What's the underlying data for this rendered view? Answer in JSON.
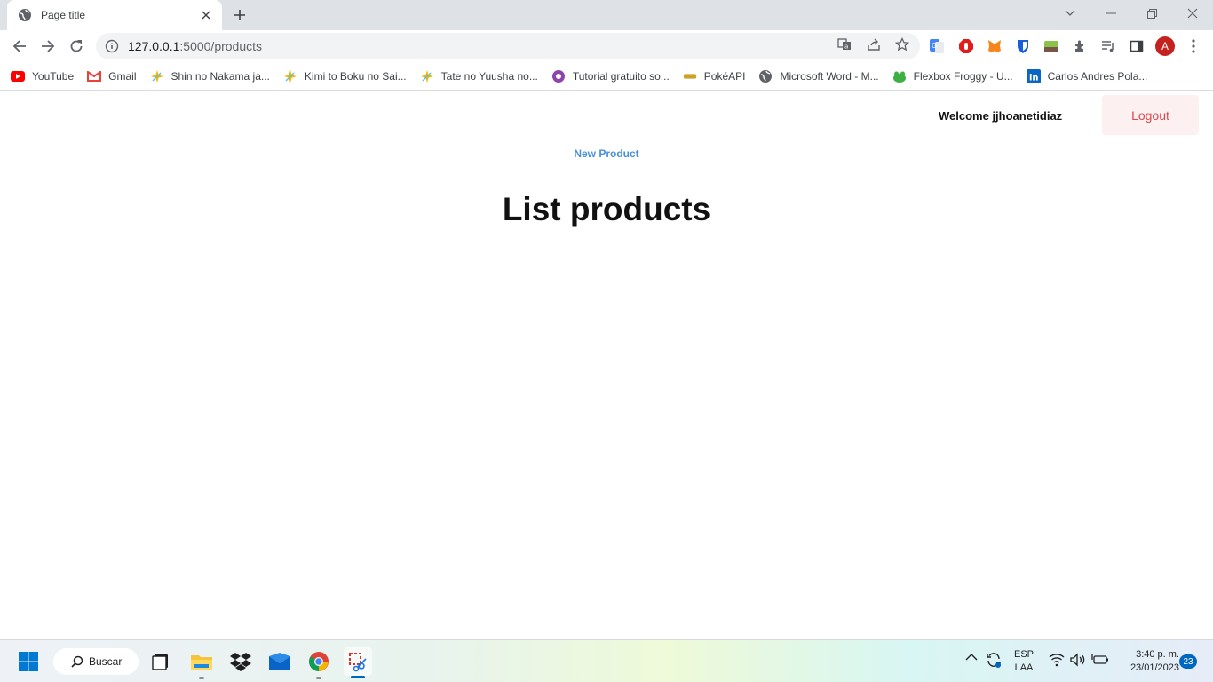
{
  "browser": {
    "tab": {
      "title": "Page title",
      "favicon": "globe-icon"
    },
    "address": {
      "host": "127.0.0.1",
      "path": ":5000/products"
    },
    "avatar_letter": "A",
    "bookmarks": [
      {
        "label": "YouTube",
        "icon": "youtube-icon",
        "color": "#ff0000"
      },
      {
        "label": "Gmail",
        "icon": "gmail-icon",
        "color": "#ea4335"
      },
      {
        "label": "Shin no Nakama ja...",
        "icon": "star-sparkle-icon",
        "color": "#f4b400"
      },
      {
        "label": "Kimi to Boku no Sai...",
        "icon": "star-sparkle-icon",
        "color": "#f4b400"
      },
      {
        "label": "Tate no Yuusha no...",
        "icon": "star-sparkle-icon",
        "color": "#f4b400"
      },
      {
        "label": "Tutorial gratuito so...",
        "icon": "purple-circle-icon",
        "color": "#8e44ad"
      },
      {
        "label": "PokéAPI",
        "icon": "pokeapi-icon",
        "color": "#c9a227"
      },
      {
        "label": "Microsoft Word - M...",
        "icon": "globe-icon",
        "color": "#5f6368"
      },
      {
        "label": "Flexbox Froggy - U...",
        "icon": "frog-icon",
        "color": "#3cb043"
      },
      {
        "label": "Carlos Andres Pola...",
        "icon": "linkedin-icon",
        "color": "#0a66c2"
      }
    ]
  },
  "app": {
    "welcome": "Welcome jjhoanetidiaz",
    "logout_label": "Logout",
    "new_product_label": "New Product",
    "heading": "List products"
  },
  "taskbar": {
    "search_label": "Buscar",
    "lang_top": "ESP",
    "lang_bottom": "LAA",
    "time": "3:40 p. m.",
    "date": "23/01/2023",
    "notifications": "23"
  },
  "colors": {
    "accent_link": "#4a90d9",
    "logout_text": "#e0474c",
    "logout_bg": "#fdf0f0"
  }
}
